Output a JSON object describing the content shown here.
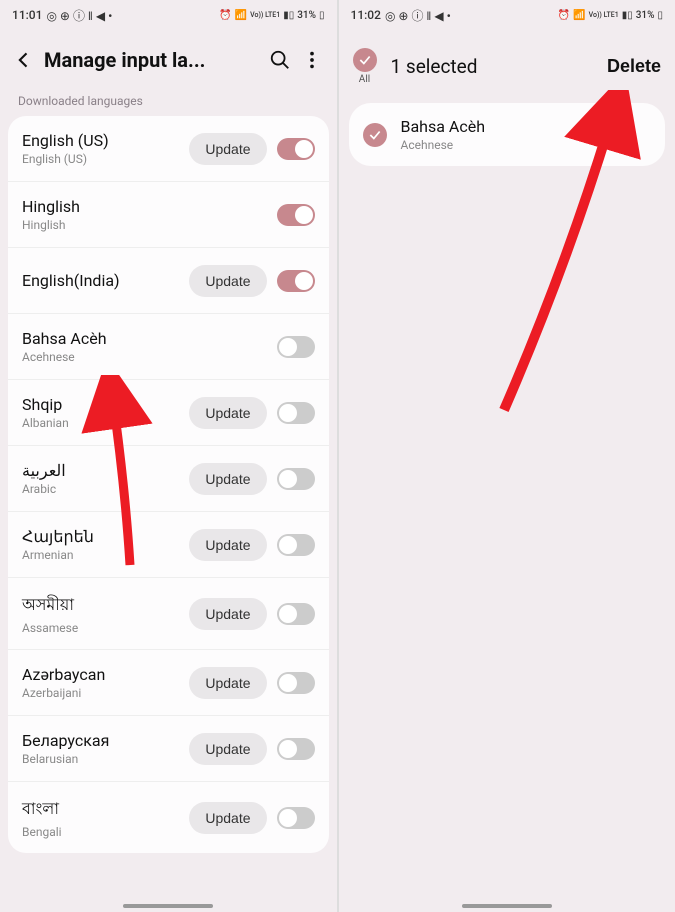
{
  "left": {
    "status": {
      "time": "11:01",
      "battery": "31%",
      "net": "Vo)) LTE1"
    },
    "header": {
      "title": "Manage input la..."
    },
    "section_label": "Downloaded languages",
    "update_label": "Update",
    "languages": [
      {
        "title": "English (US)",
        "sub": "English (US)",
        "update": true,
        "on": true
      },
      {
        "title": "Hinglish",
        "sub": "Hinglish",
        "update": false,
        "on": true
      },
      {
        "title": "English(India)",
        "sub": "",
        "update": true,
        "on": true
      },
      {
        "title": "Bahsa Acèh",
        "sub": "Acehnese",
        "update": false,
        "on": false
      },
      {
        "title": "Shqip",
        "sub": "Albanian",
        "update": true,
        "on": false
      },
      {
        "title": "العربية",
        "sub": "Arabic",
        "update": true,
        "on": false
      },
      {
        "title": "Հայերեն",
        "sub": "Armenian",
        "update": true,
        "on": false
      },
      {
        "title": "অসমীয়া",
        "sub": "Assamese",
        "update": true,
        "on": false
      },
      {
        "title": "Azərbaycan",
        "sub": "Azerbaijani",
        "update": true,
        "on": false
      },
      {
        "title": "Беларуская",
        "sub": "Belarusian",
        "update": true,
        "on": false
      },
      {
        "title": "বাংলা",
        "sub": "Bengali",
        "update": true,
        "on": false
      }
    ]
  },
  "right": {
    "status": {
      "time": "11:02",
      "battery": "31%",
      "net": "Vo)) LTE1"
    },
    "header": {
      "all_label": "All",
      "title": "1 selected",
      "delete_label": "Delete"
    },
    "item": {
      "title": "Bahsa Acèh",
      "sub": "Acehnese"
    }
  }
}
